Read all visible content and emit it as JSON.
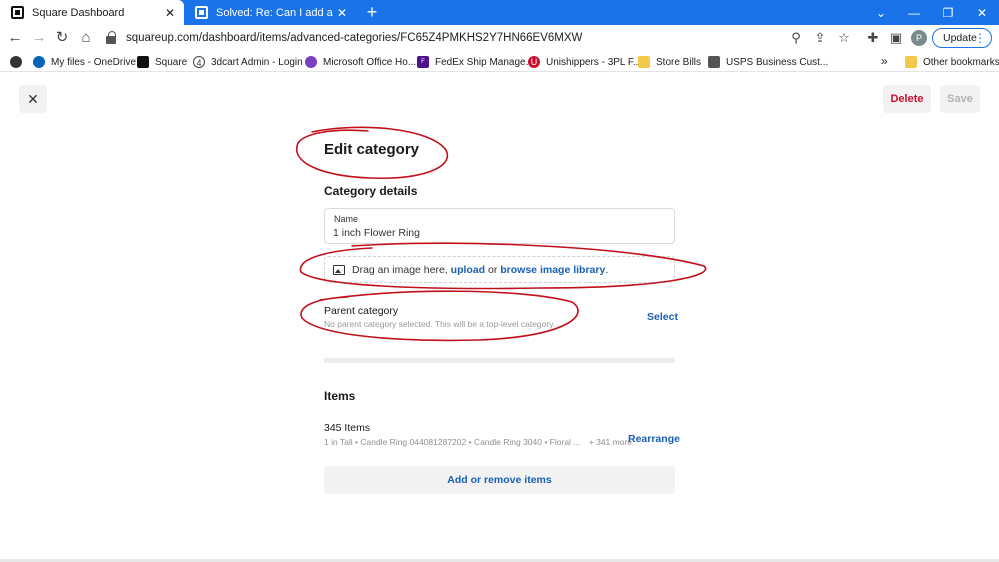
{
  "browser": {
    "tabs": [
      {
        "title": "Square Dashboard",
        "close": "✕"
      },
      {
        "title": "Solved: Re: Can I add a photo to",
        "close": "✕"
      }
    ],
    "new_tab": "+",
    "window_controls": {
      "minimize": "—",
      "restore": "❐",
      "close": "✕",
      "tab_search": "⌄"
    },
    "nav": {
      "back": "←",
      "forward": "→",
      "reload": "↻",
      "home": "⌂"
    },
    "url": "squareup.com/dashboard/items/advanced-categories/FC65Z4PMKHS2Y7HN66EV6MXW",
    "omni_icons": {
      "zoom": "⚲",
      "share": "⇪",
      "star": "☆",
      "extensions": "✚",
      "sidepanel": "▣"
    },
    "profile_initial": "P",
    "update_label": "Update",
    "update_menu": "⋮",
    "bookmarks": [
      {
        "label": "My files - OneDrive",
        "color": "#0364b8"
      },
      {
        "label": "Square",
        "color": "#111111"
      },
      {
        "label": "3dcart Admin - Login",
        "color": "#444444"
      },
      {
        "label": "Microsoft Office Ho...",
        "color": "#7a3fbf"
      },
      {
        "label": "FedEx Ship Manage...",
        "color": "#4d148c"
      },
      {
        "label": "Unishippers - 3PL F...",
        "color": "#c8102e"
      },
      {
        "label": "Store Bills",
        "color": "#f2c94c"
      },
      {
        "label": "USPS Business Cust...",
        "color": "#555555"
      }
    ],
    "bookmarks_more": "»",
    "other_bookmarks": "Other bookmarks"
  },
  "page": {
    "close_label": "✕",
    "delete_label": "Delete",
    "save_label": "Save",
    "title": "Edit category",
    "details_heading": "Category details",
    "name_field": {
      "label": "Name",
      "value": "1 inch Flower Ring"
    },
    "dropzone": {
      "prefix": "Drag an image here,",
      "upload": "upload",
      "middle": "or",
      "browse": "browse image library",
      "suffix": "."
    },
    "parent": {
      "title": "Parent category",
      "subtitle": "No parent category selected. This will be a top-level category.",
      "select_label": "Select"
    },
    "items": {
      "heading": "Items",
      "count": "345 Items",
      "preview": "1 in Tall • Candle Ring 044081287202 • Candle Ring 3040 • Floral ...",
      "more": "+ 341 more",
      "rearrange_label": "Rearrange",
      "add_remove_label": "Add or remove items"
    }
  },
  "colors": {
    "chrome_blue": "#1a73e8",
    "link_blue": "#1a5fb4",
    "delete_red": "#c8102e",
    "annotation_red": "#c0101a"
  }
}
